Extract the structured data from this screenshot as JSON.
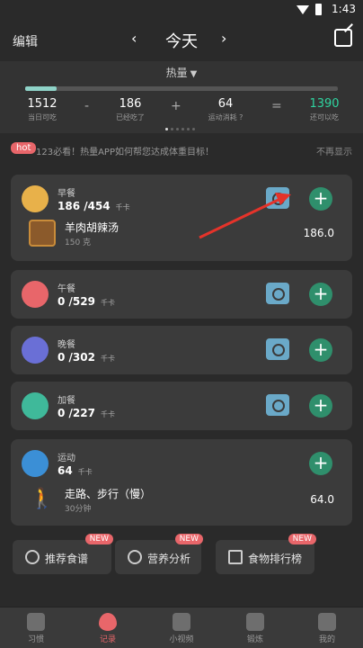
{
  "status": {
    "time": "1:43"
  },
  "header": {
    "edit_label": "编辑",
    "prev": "‹",
    "next": "›",
    "day": "今天"
  },
  "summary": {
    "selector": "热量",
    "progress": 0.1,
    "stats": [
      {
        "value": "1512",
        "label": "当日可吃"
      },
      {
        "value": "186",
        "label": "已经吃了"
      },
      {
        "value": "64",
        "label": "运动消耗 ?"
      },
      {
        "value": "1390",
        "label": "还可以吃"
      }
    ],
    "ops": [
      "-",
      "+",
      "="
    ],
    "accent_color": "#2fd4a0"
  },
  "notice": {
    "badge": "hot",
    "text": "123必看！热量APP如何帮您达成体重目标！",
    "dismiss": "不再显示"
  },
  "meals": [
    {
      "title": "早餐",
      "kcal": "186 /454",
      "unit": "千卡",
      "icon": "sunrise-icon",
      "color": "#e8b14a",
      "food": {
        "name": "羊肉胡辣汤",
        "sub": "150 克",
        "value": "186.0"
      }
    },
    {
      "title": "午餐",
      "kcal": "0 /529",
      "unit": "千卡",
      "icon": "fork-knife-icon",
      "color": "#e8666a"
    },
    {
      "title": "晚餐",
      "kcal": "0 /302",
      "unit": "千卡",
      "icon": "moon-icon",
      "color": "#6a6fd6"
    },
    {
      "title": "加餐",
      "kcal": "0 /227",
      "unit": "千卡",
      "icon": "snack-icon",
      "color": "#3fb99a"
    }
  ],
  "exercise": {
    "title": "运动",
    "kcal": "64",
    "unit": "千卡",
    "icon": "shoe-icon",
    "item": {
      "name": "走路、步行（慢）",
      "sub": "30分钟",
      "value": "64.0"
    }
  },
  "quick": [
    {
      "label": "推荐食谱",
      "badge": "NEW"
    },
    {
      "label": "营养分析",
      "badge": "NEW"
    },
    {
      "label": "食物排行榜",
      "badge": "NEW"
    }
  ],
  "tabs": [
    {
      "label": "习惯"
    },
    {
      "label": "记录"
    },
    {
      "label": "小视频"
    },
    {
      "label": "锻炼"
    },
    {
      "label": "我的"
    }
  ]
}
